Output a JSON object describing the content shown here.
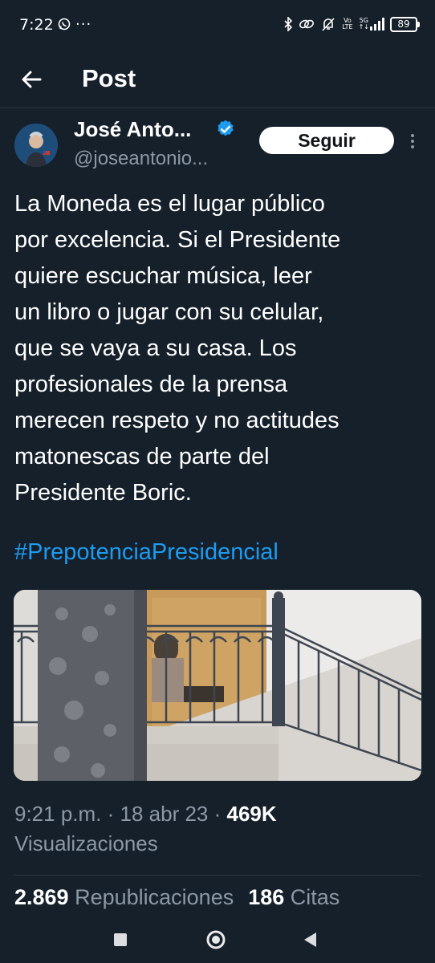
{
  "status_bar": {
    "time": "7:22",
    "overflow": "···",
    "network_top": "Vo",
    "network_bottom": "LTE",
    "network_gen": "5G",
    "battery": "89"
  },
  "header": {
    "title": "Post"
  },
  "author": {
    "name": "José Anto...",
    "handle": "@joseantonio...",
    "follow_label": "Seguir"
  },
  "tweet": {
    "text": "La Moneda es el lugar público\npor excelencia. Si el Presidente\nquiere escuchar música, leer\nun libro o jugar con su celular,\nque se vaya a su casa. Los\nprofesionales de la prensa\nmerecen respeto y no actitudes\nmatonescas de parte del\nPresidente Boric.",
    "hashtag": "#PrepotenciaPresidencial"
  },
  "meta": {
    "time": "9:21 p.m.",
    "separator": " · ",
    "date": "18 abr 23",
    "views": "469K",
    "views_label": "Visualizaciones"
  },
  "stats": {
    "reposts_count": "2.869",
    "reposts_label": "Republicaciones",
    "quotes_count": "186",
    "quotes_label": "Citas"
  },
  "colors": {
    "background": "#15202b",
    "accent": "#1d9bf0",
    "secondary_text": "#8b98a5"
  },
  "icons": {
    "back": "arrow-left-icon",
    "verified": "verified-badge-icon",
    "more": "more-vertical-icon",
    "nav_recent": "square-icon",
    "nav_home": "circle-icon",
    "nav_back": "triangle-icon"
  }
}
